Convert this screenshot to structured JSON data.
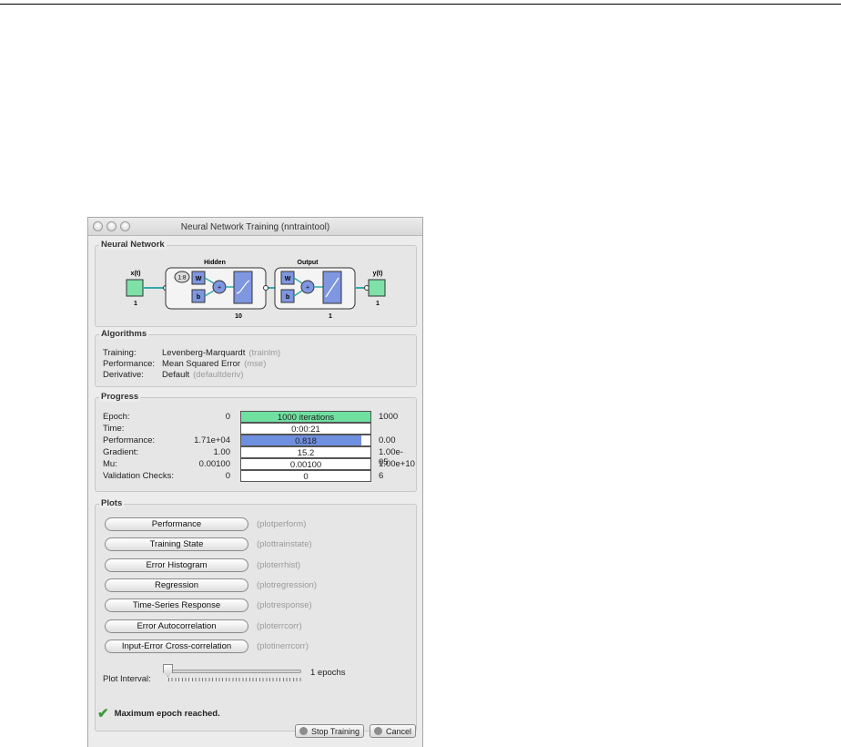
{
  "window": {
    "title": "Neural Network Training (nntraintool)"
  },
  "network": {
    "label": "Neural Network",
    "input_label": "x(t)",
    "input_size": "1",
    "hidden_title": "Hidden",
    "hidden_size": "10",
    "delay": "1:8",
    "output_title": "Output",
    "output_size": "1",
    "output_label": "y(t)",
    "out_size": "1",
    "w": "W",
    "b": "b",
    "plus": "+"
  },
  "algorithms": {
    "label": "Algorithms",
    "rows": [
      {
        "key": "Training:",
        "value": "Levenberg-Marquardt",
        "hint": "(trainlm)"
      },
      {
        "key": "Performance:",
        "value": "Mean Squared Error",
        "hint": "(mse)"
      },
      {
        "key": "Derivative:",
        "value": "Default",
        "hint": "(defaultderiv)"
      }
    ]
  },
  "progress": {
    "label": "Progress",
    "rows": [
      {
        "key": "Epoch:",
        "start": "0",
        "bar": "1000 iterations",
        "end": "1000",
        "fill": 1.0,
        "color": "#6fe0a0"
      },
      {
        "key": "Time:",
        "start": "",
        "bar": "0:00:21",
        "end": "",
        "fill": 0,
        "color": "#ffffff"
      },
      {
        "key": "Performance:",
        "start": "1.71e+04",
        "bar": "0.818",
        "end": "0.00",
        "fill": 0.93,
        "color": "#6f8fe0"
      },
      {
        "key": "Gradient:",
        "start": "1.00",
        "bar": "15.2",
        "end": "1.00e-05",
        "fill": 0,
        "color": "#ffffff"
      },
      {
        "key": "Mu:",
        "start": "0.00100",
        "bar": "0.00100",
        "end": "1.00e+10",
        "fill": 0,
        "color": "#ffffff"
      },
      {
        "key": "Validation Checks:",
        "start": "0",
        "bar": "0",
        "end": "6",
        "fill": 0,
        "color": "#ffffff"
      }
    ]
  },
  "plots": {
    "label": "Plots",
    "buttons": [
      {
        "label": "Performance",
        "hint": "(plotperform)"
      },
      {
        "label": "Training State",
        "hint": "(plottrainstate)"
      },
      {
        "label": "Error Histogram",
        "hint": "(ploterrhist)"
      },
      {
        "label": "Regression",
        "hint": "(plotregression)"
      },
      {
        "label": "Time-Series Response",
        "hint": "(plotresponse)"
      },
      {
        "label": "Error Autocorrelation",
        "hint": "(ploterrcorr)"
      },
      {
        "label": "Input-Error Cross-correlation",
        "hint": "(plotinerrcorr)"
      }
    ],
    "interval_label": "Plot Interval:",
    "interval_value": "1 epochs",
    "interval_level": 0
  },
  "status": {
    "message": "Maximum epoch reached."
  },
  "footer": {
    "stop_label": "Stop Training",
    "cancel_label": "Cancel"
  }
}
